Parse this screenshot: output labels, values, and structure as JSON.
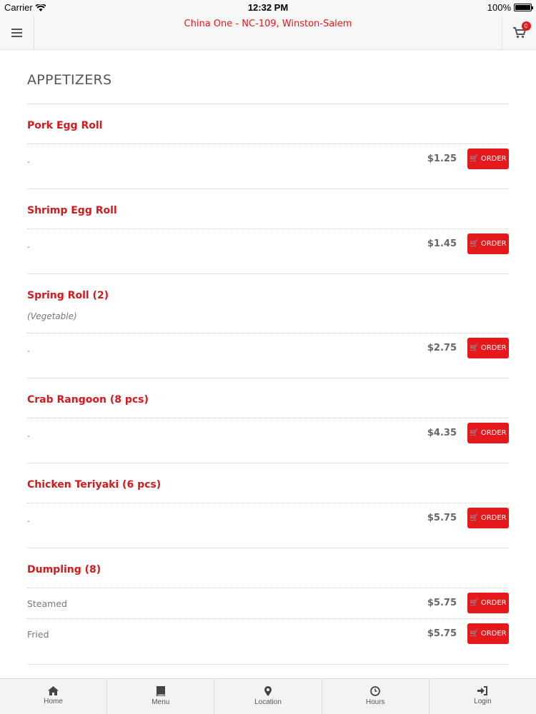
{
  "status": {
    "carrier": "Carrier",
    "time": "12:32 PM",
    "battery": "100%"
  },
  "header": {
    "title": "China One - NC-109, Winston-Salem",
    "cart_count": "0"
  },
  "section": {
    "title": "APPETIZERS"
  },
  "order_label": "ORDER",
  "items": [
    {
      "name": "Pork Egg Roll",
      "options": [
        {
          "label": ".",
          "price": "$1.25"
        }
      ]
    },
    {
      "name": "Shrimp Egg Roll",
      "options": [
        {
          "label": ".",
          "price": "$1.45"
        }
      ]
    },
    {
      "name": "Spring Roll (2)",
      "desc": "(Vegetable)",
      "options": [
        {
          "label": ".",
          "price": "$2.75"
        }
      ]
    },
    {
      "name": "Crab Rangoon (8 pcs)",
      "options": [
        {
          "label": ".",
          "price": "$4.35"
        }
      ]
    },
    {
      "name": "Chicken Teriyaki (6 pcs)",
      "options": [
        {
          "label": ".",
          "price": "$5.75"
        }
      ]
    },
    {
      "name": "Dumpling (8)",
      "options": [
        {
          "label": "Steamed",
          "price": "$5.75"
        },
        {
          "label": "Fried",
          "price": "$5.75"
        }
      ]
    }
  ],
  "tabs": [
    {
      "label": "Home",
      "icon": "home-icon"
    },
    {
      "label": "Menu",
      "icon": "book-icon"
    },
    {
      "label": "Location",
      "icon": "map-marker-icon"
    },
    {
      "label": "Hours",
      "icon": "clock-icon"
    },
    {
      "label": "Login",
      "icon": "login-icon"
    }
  ],
  "colors": {
    "accent": "#e5181b",
    "item_name": "#d3191c"
  }
}
